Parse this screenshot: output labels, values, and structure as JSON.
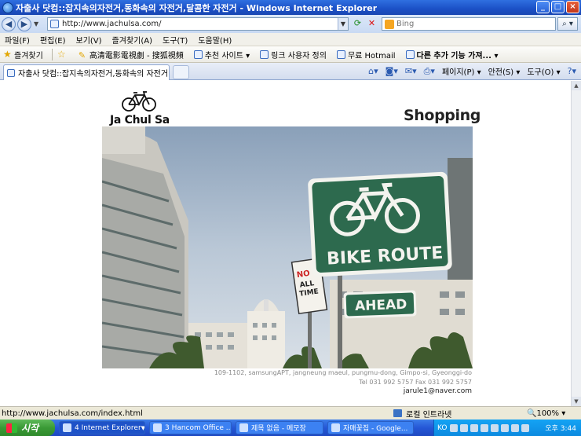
{
  "window": {
    "title": "자출사 닷컴::잡지속의자전거,동화속의 자전거,달콤한 자전거 - Windows Internet Explorer",
    "buttons": {
      "minimize": "_",
      "maximize": "□",
      "close": "×"
    }
  },
  "address_bar": {
    "url": "http://www.jachulsa.com/",
    "search_placeholder": "Bing"
  },
  "menu": [
    "파일(F)",
    "편집(E)",
    "보기(V)",
    "즐겨찾기(A)",
    "도구(T)",
    "도움말(H)"
  ],
  "favorites_bar": {
    "favorites_label": "즐겨찾기",
    "items": [
      "高清電影電視劇 - 搜狐視頻",
      "추천 사이트 ▾",
      "링크 사용자 정의",
      "무료 Hotmail",
      "다른 추가 기능 가져... ▾"
    ]
  },
  "tab": {
    "title": "자출사 닷컴::잡지속의자전거,동화속의 자전거...."
  },
  "command_bar": {
    "page": "페이지(P) ▾",
    "safety": "안전(S) ▾",
    "tools": "도구(O) ▾"
  },
  "page": {
    "brand": "Ja Chul Sa",
    "section_title": "Shopping",
    "sign_text_1": "BIKE ROUTE",
    "sign_text_2": "AHEAD",
    "sign_small_1": "NO",
    "sign_small_2": "ALL",
    "sign_small_3": "TIME",
    "address_line": "109-1102, samsungAPT, jangneung maeul, pungmu-dong, Gimpo-si, Gyeonggi-do",
    "phone_line": "Tel 031 992 5757 Fax 031 992 5757",
    "email": "jarule1@naver.com"
  },
  "status_bar": {
    "url": "http://www.jachulsa.com/index.html",
    "zone": "로컬 인트라넷",
    "zoom": "100%"
  },
  "taskbar": {
    "start": "시작",
    "buttons": [
      "4 Internet Explorer",
      "3 Hancom Office ...",
      "제목 없음 - 메모장",
      "자매꽃집 - Google..."
    ],
    "language": "KO",
    "clock": "오후 3:44"
  }
}
